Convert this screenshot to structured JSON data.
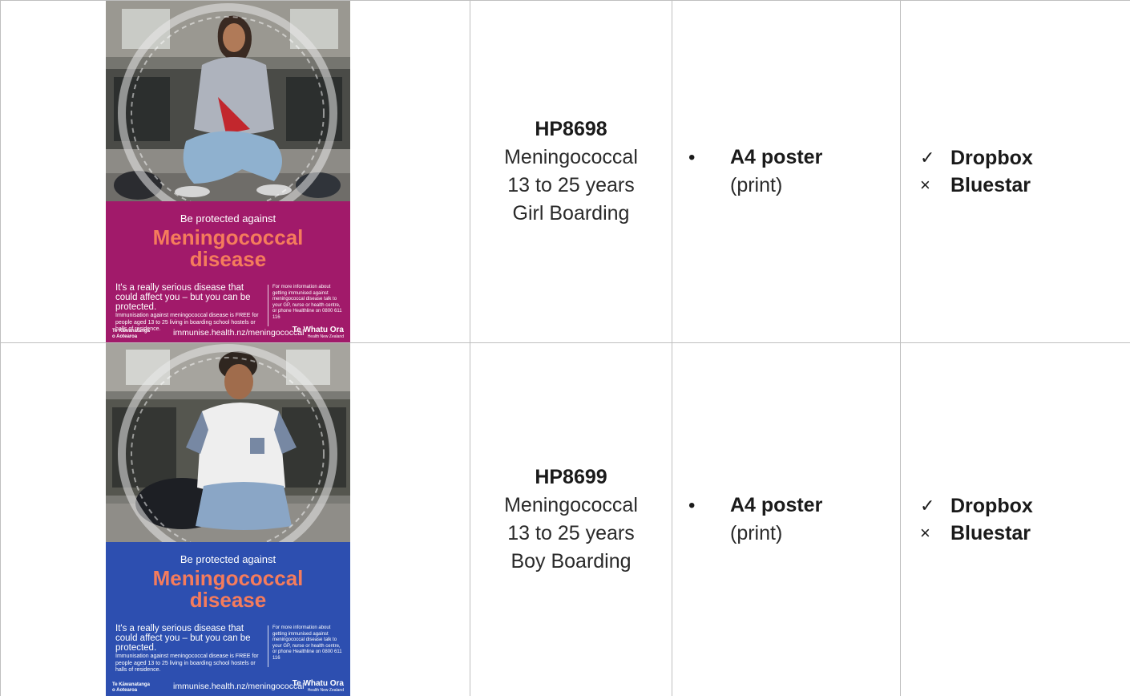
{
  "rows": [
    {
      "code": "HP8698",
      "desc_line1": "Meningococcal",
      "desc_line2": "13 to 25 years",
      "desc_line3": "Girl Boarding",
      "format_main": "A4 poster",
      "format_sub": "(print)",
      "dist1": "Dropbox",
      "dist2": "Bluestar",
      "poster": {
        "tagline": "Be protected against",
        "headline1": "Meningococcal",
        "headline2": "disease",
        "lead": "It's a really serious disease that could affect you – but you can be protected.",
        "body": "Immunisation against meningococcal disease is FREE for people aged 13 to 25 living in boarding school hostels or halls of residence.",
        "info": "For more information about getting immunised against meningococcal disease talk to your GP, nurse or health centre, or phone Healthline on 0800 611 116",
        "gov1": "Te Kāwanatanga",
        "gov2": "o Aotearoa",
        "url": "immunise.health.nz/meningococcal",
        "brand": "Te Whatu Ora",
        "brand_sub": "Health New Zealand"
      }
    },
    {
      "code": "HP8699",
      "desc_line1": "Meningococcal",
      "desc_line2": "13 to 25 years",
      "desc_line3": "Boy Boarding",
      "format_main": "A4 poster",
      "format_sub": "(print)",
      "dist1": "Dropbox",
      "dist2": "Bluestar",
      "poster": {
        "tagline": "Be protected against",
        "headline1": "Meningococcal",
        "headline2": "disease",
        "lead": "It's a really serious disease that could affect you – but you can be protected.",
        "body": "Immunisation against meningococcal disease is FREE for people aged 13 to 25 living in boarding school hostels or halls of residence.",
        "info": "For more information about getting immunised against meningococcal disease talk to your GP, nurse or health centre, or phone Healthline on 0800 611 116",
        "gov1": "Te Kāwanatanga",
        "gov2": "o Aotearoa",
        "url": "immunise.health.nz/meningococcal",
        "brand": "Te Whatu Ora",
        "brand_sub": "Health New Zealand"
      }
    }
  ],
  "icons": {
    "bullet": "•",
    "check": "✓",
    "cross": "×"
  },
  "colors": {
    "girl_poster_bg": "#a11a6a",
    "boy_poster_bg": "#2d4fb0",
    "headline": "#f57c5c"
  }
}
